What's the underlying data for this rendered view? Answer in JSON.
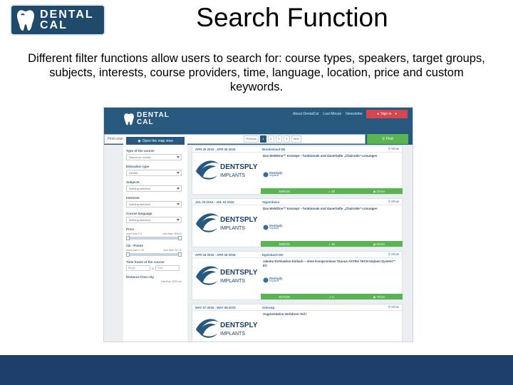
{
  "slide": {
    "logo_line1": "DENTAL",
    "logo_line2": "CAL",
    "title": "Search Function",
    "description": "Different filter functions allow users to search for: course types, speakers, target groups, subjects, interests, course providers, time, language, location, price and custom keywords."
  },
  "site": {
    "logo_line1": "DENTAL",
    "logo_line2": "CAL",
    "top_links": [
      "About DentalCal",
      "Last Minute",
      "Newsletter"
    ],
    "signin_label": "Sign in",
    "search_placeholder": "Find course...",
    "find_label": "Find"
  },
  "sidebar": {
    "open_overview_label": "Open the map view",
    "filters": [
      {
        "label": "Type of the course",
        "value": "Hands-on course"
      },
      {
        "label": "Education type",
        "value": "Dentist"
      },
      {
        "label": "Subjects",
        "value": "Nothing selected"
      },
      {
        "label": "Interests",
        "value": "Nothing selected"
      },
      {
        "label": "Course language",
        "value": "Nothing selected"
      }
    ],
    "price": {
      "label": "Price",
      "min": "more than 0 €",
      "max": "less than 3500 €"
    },
    "cepoints": {
      "label": "CE - Points",
      "min": "more than 0 CE",
      "max": "less than 30 CE"
    },
    "time": {
      "label": "Time frame of the course",
      "from": "Begin",
      "sep": "to",
      "to": "End"
    },
    "distance": {
      "label": "Distance from city",
      "max": "less than 1000 km"
    }
  },
  "pager": [
    "Previous",
    "1",
    "2",
    "3",
    "4",
    "Next"
  ],
  "results": [
    {
      "date": "APR 25 2015 - APR 26 2015",
      "location": "Bundesland DE",
      "show": "Show",
      "title": "Das WeldOne™ Konzept – funktionale und dauerhafte „Chairside“-Lösungen",
      "brand1": "DENTSPLY",
      "brand2": "IMPLANTS",
      "small1": "Dentsply",
      "small2": "Implants",
      "price": "€490,00",
      "points": "18",
      "distance": "22 km"
    },
    {
      "date": "JUL 03 2015 - JUL 04 2015",
      "location": "Oppenheim",
      "show": "Show",
      "title": "Das WeldOne™ Konzept – funktionale und dauerhafte „Chairside“-Lösungen",
      "brand1": "DENTSPLY",
      "brand2": "IMPLANTS",
      "small1": "Dentsply",
      "small2": "Implants",
      "price": "€490,00",
      "points": "18",
      "distance": "62 km"
    },
    {
      "date": "APR 18 2015 - APR 18 2015",
      "location": "Egelsbach DE",
      "show": "Show",
      "title": "Jakobs EVAluation Einfach – ohne Kompromisse Taunus ASTRA TECH Implant System™ EV",
      "brand1": "DENTSPLY",
      "brand2": "IMPLANTS",
      "small1": "Dentsply",
      "small2": "Implants",
      "price": "€270,00",
      "points": "0",
      "distance": "70 km"
    },
    {
      "date": "MAY 07 2015 - MAY 08 2015",
      "location": "Ostrong",
      "show": "Show",
      "title": "Augmentative Verfahren Teil I",
      "brand1": "DENTSPLY",
      "brand2": "IMPLANTS",
      "small1": "",
      "small2": "",
      "price": "",
      "points": "",
      "distance": ""
    }
  ],
  "colors": {
    "brand_blue": "#27587e",
    "green": "#5ab453",
    "signin_red": "#d4474f",
    "footer": "#1d3f6a"
  }
}
